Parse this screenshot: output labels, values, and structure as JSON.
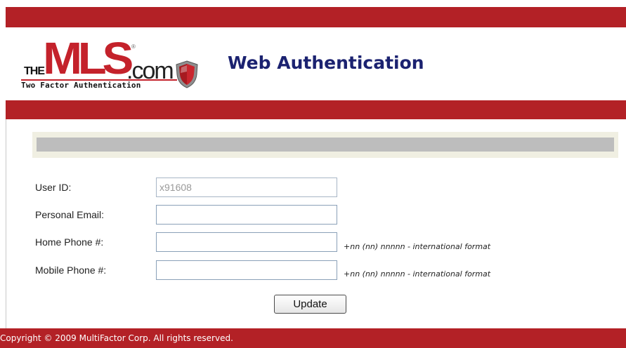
{
  "logo": {
    "prefix": "THE",
    "brand": "MLS",
    "trademark": "®",
    "suffix": ".com",
    "tagline": "Two Factor Authentication",
    "icon": "shield-icon"
  },
  "header": {
    "title": "Web Authentication"
  },
  "form": {
    "user_id": {
      "label": "User ID:",
      "value": "x91608"
    },
    "personal_email": {
      "label": "Personal Email:",
      "value": ""
    },
    "home_phone": {
      "label": "Home Phone #:",
      "value": "",
      "hint": "+nn (nn) nnnnn - international format"
    },
    "mobile_phone": {
      "label": "Mobile Phone #:",
      "value": "",
      "hint": "+nn (nn) nnnnn - international format"
    },
    "update_label": "Update"
  },
  "footer": {
    "copyright": "Copyright © 2009 MultiFactor Corp. All rights reserved."
  },
  "colors": {
    "brand_red": "#b32126",
    "title_blue": "#1b2270"
  }
}
